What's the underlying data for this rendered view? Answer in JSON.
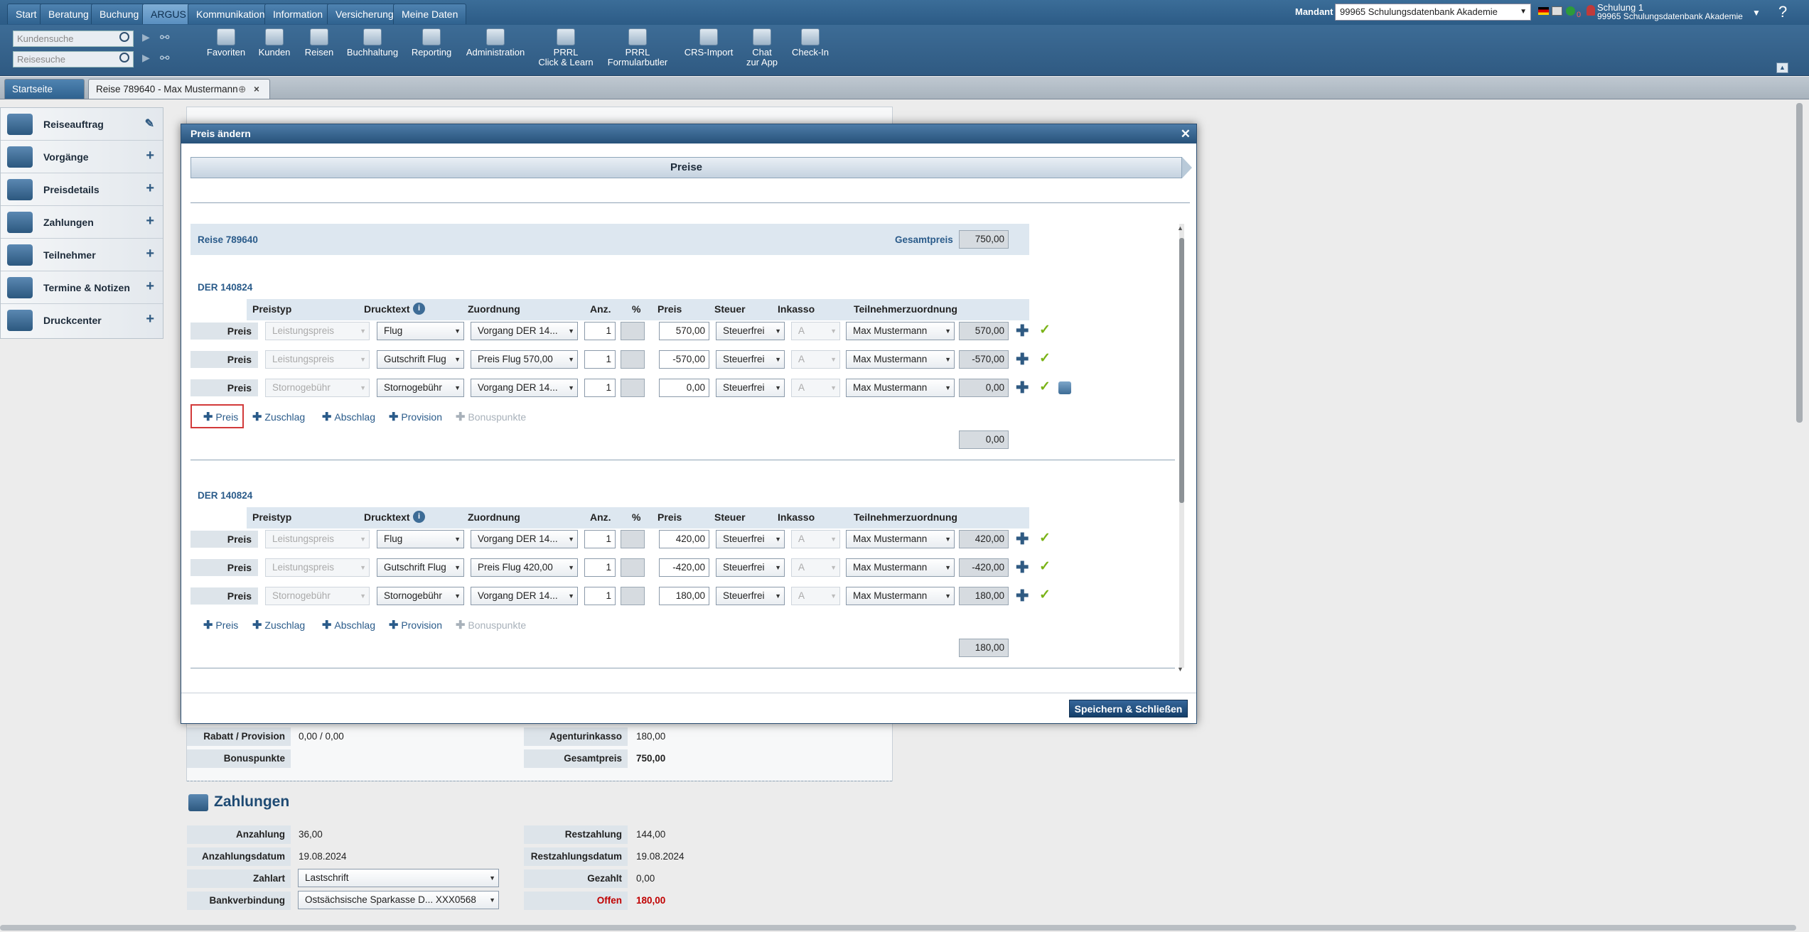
{
  "nav": {
    "tabs": [
      "Start",
      "Beratung",
      "Buchung",
      "ARGUS",
      "Kommunikation",
      "Information",
      "Versicherung",
      "Meine Daten"
    ],
    "mandant_label": "Mandant",
    "mandant_value": "99965 Schulungsdatenbank Akademie",
    "status_count": "0",
    "user_name": "Schulung 1",
    "user_company": "99965 Schulungsdatenbank Akademie",
    "help": "?"
  },
  "search": {
    "customer_placeholder": "Kundensuche",
    "trip_placeholder": "Reisesuche"
  },
  "toolbar": {
    "buttons": [
      {
        "l1": "Favoriten",
        "l2": ""
      },
      {
        "l1": "Kunden",
        "l2": ""
      },
      {
        "l1": "Reisen",
        "l2": ""
      },
      {
        "l1": "Buchhaltung",
        "l2": ""
      },
      {
        "l1": "Reporting",
        "l2": ""
      },
      {
        "l1": "Administration",
        "l2": ""
      },
      {
        "l1": "PRRL",
        "l2": "Click & Learn"
      },
      {
        "l1": "PRRL",
        "l2": "Formularbutler"
      },
      {
        "l1": "CRS-Import",
        "l2": ""
      },
      {
        "l1": "Chat",
        "l2": "zur App"
      },
      {
        "l1": "Check-In",
        "l2": ""
      }
    ]
  },
  "doctabs": {
    "home": "Startseite",
    "trip": "Reise 789640 - Max Mustermann"
  },
  "sidebar": {
    "items": [
      "Reiseauftrag",
      "Vorgänge",
      "Preisdetails",
      "Zahlungen",
      "Teilnehmer",
      "Termine & Notizen",
      "Druckcenter"
    ]
  },
  "background": {
    "rabatt_label": "Rabatt / Provision",
    "rabatt_value": "0,00 / 0,00",
    "bonus_label": "Bonuspunkte",
    "bonus_value": "",
    "agentur_label": "Agenturinkasso",
    "agentur_value": "180,00",
    "gesamt_label": "Gesamtpreis",
    "gesamt_value": "750,00",
    "zahlungen_title": "Zahlungen",
    "anzahlung_label": "Anzahlung",
    "anzahlung_value": "36,00",
    "anzahlungsdatum_label": "Anzahlungsdatum",
    "anzahlungsdatum_value": "19.08.2024",
    "zahlart_label": "Zahlart",
    "zahlart_value": "Lastschrift",
    "bank_label": "Bankverbindung",
    "bank_value": "Ostsächsische Sparkasse D... XXX0568",
    "rest_label": "Restzahlung",
    "rest_value": "144,00",
    "restdatum_label": "Restzahlungsdatum",
    "restdatum_value": "19.08.2024",
    "gezahlt_label": "Gezahlt",
    "gezahlt_value": "0,00",
    "offen_label": "Offen",
    "offen_value": "180,00"
  },
  "modal": {
    "title": "Preis ändern",
    "step": "Preise",
    "trip_label": "Reise 789640",
    "total_label": "Gesamtpreis",
    "total_value": "750,00",
    "columns": [
      "Preistyp",
      "Drucktext",
      "Zuordnung",
      "Anz.",
      "%",
      "Preis",
      "Steuer",
      "Inkasso",
      "Teilnehmerzuordnung"
    ],
    "actions": [
      "Preis",
      "Zuschlag",
      "Abschlag",
      "Provision",
      "Bonuspunkte"
    ],
    "row_label": "Preis",
    "save_label": "Speichern & Schließen",
    "sections": [
      {
        "title": "DER 140824",
        "subtotal": "0,00",
        "rows": [
          {
            "preistyp": "Leistungspreis",
            "drucktext": "Flug",
            "zuordnung": "Vorgang DER 14...",
            "anz": "1",
            "preis": "570,00",
            "steuer": "Steuerfrei",
            "inkasso": "A",
            "teilnehmer": "Max Mustermann",
            "summe": "570,00"
          },
          {
            "preistyp": "Leistungspreis",
            "drucktext": "Gutschrift Flug",
            "zuordnung": "Preis Flug 570,00",
            "anz": "1",
            "preis": "-570,00",
            "steuer": "Steuerfrei",
            "inkasso": "A",
            "teilnehmer": "Max Mustermann",
            "summe": "-570,00"
          },
          {
            "preistyp": "Stornogebühr",
            "drucktext": "Stornogebühr",
            "zuordnung": "Vorgang DER 14...",
            "anz": "1",
            "preis": "0,00",
            "steuer": "Steuerfrei",
            "inkasso": "A",
            "teilnehmer": "Max Mustermann",
            "summe": "0,00"
          }
        ]
      },
      {
        "title": "DER 140824",
        "subtotal": "180,00",
        "rows": [
          {
            "preistyp": "Leistungspreis",
            "drucktext": "Flug",
            "zuordnung": "Vorgang DER 14...",
            "anz": "1",
            "preis": "420,00",
            "steuer": "Steuerfrei",
            "inkasso": "A",
            "teilnehmer": "Max Mustermann",
            "summe": "420,00"
          },
          {
            "preistyp": "Leistungspreis",
            "drucktext": "Gutschrift Flug",
            "zuordnung": "Preis Flug 420,00",
            "anz": "1",
            "preis": "-420,00",
            "steuer": "Steuerfrei",
            "inkasso": "A",
            "teilnehmer": "Max Mustermann",
            "summe": "-420,00"
          },
          {
            "preistyp": "Stornogebühr",
            "drucktext": "Stornogebühr",
            "zuordnung": "Vorgang DER 14...",
            "anz": "1",
            "preis": "180,00",
            "steuer": "Steuerfrei",
            "inkasso": "A",
            "teilnehmer": "Max Mustermann",
            "summe": "180,00"
          }
        ]
      }
    ]
  },
  "colors": {
    "brand": "#2c5b86",
    "link": "#2a5b8a",
    "check": "#7ab317",
    "offen": "#c00000"
  }
}
